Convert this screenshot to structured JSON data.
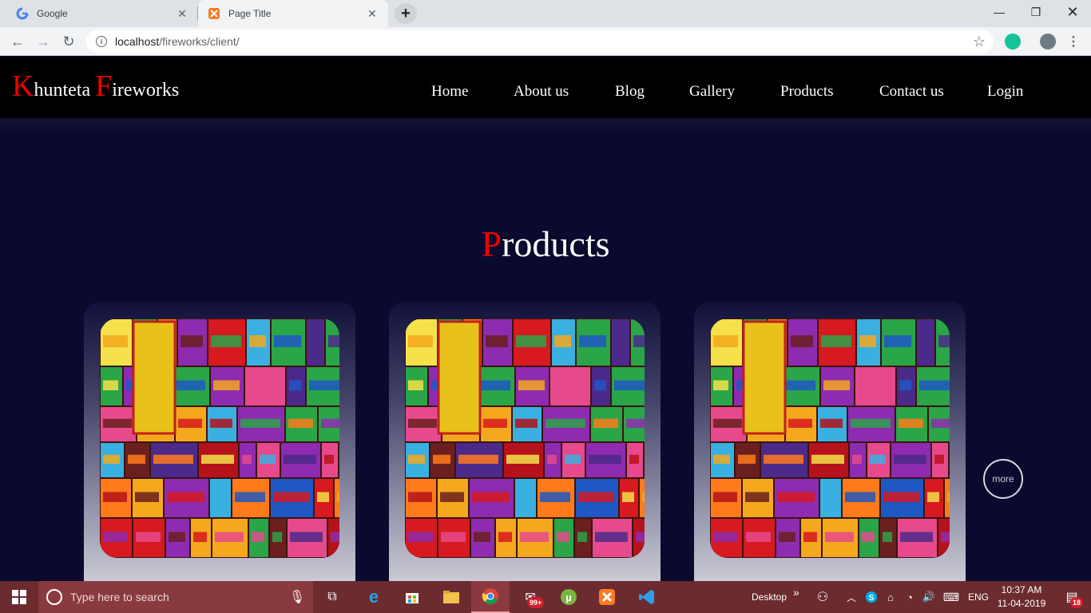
{
  "browser": {
    "tabs": [
      {
        "title": "Google",
        "favicon": "google-g-icon"
      },
      {
        "title": "Page Title",
        "favicon": "xampp-icon"
      }
    ],
    "url_host": "localhost",
    "url_path": "/fireworks/client/"
  },
  "site": {
    "logo": {
      "first_initial": "K",
      "first_rest": "hunteta ",
      "second_initial": "F",
      "second_rest": "ireworks"
    },
    "nav": [
      "Home",
      "About us",
      "Blog",
      "Gallery",
      "Products",
      "Contact us",
      "Login"
    ],
    "section_title": {
      "initial": "P",
      "rest": "roducts"
    },
    "more_label": "more",
    "colors": {
      "accent": "#ee0000",
      "header_bg": "#000000",
      "page_bg": "#0a0a2e"
    }
  },
  "taskbar": {
    "search_placeholder": "Type here to search",
    "desktop_label": "Desktop",
    "language": "ENG",
    "time": "10:37 AM",
    "date": "11-04-2019",
    "mail_badge": "99+",
    "notifications_badge": "18"
  }
}
